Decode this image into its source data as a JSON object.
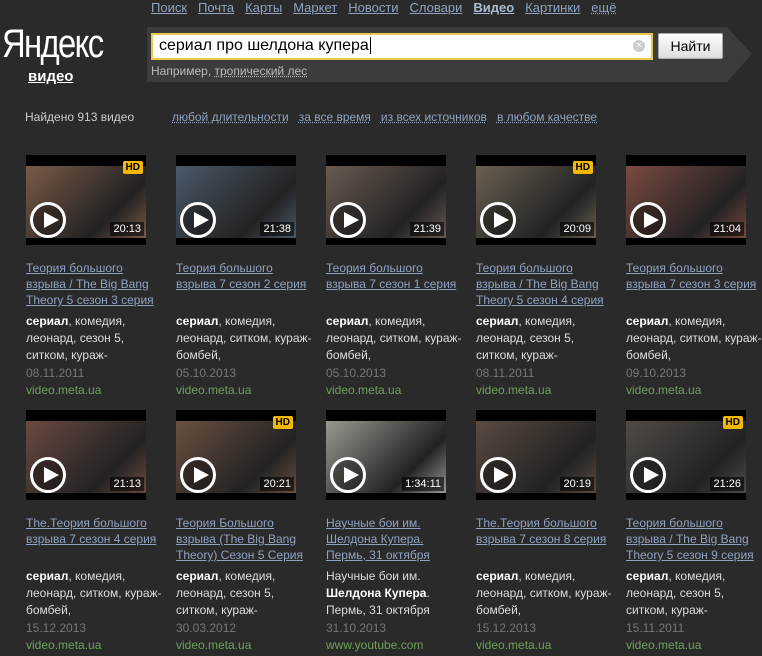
{
  "nav": [
    "Поиск",
    "Почта",
    "Карты",
    "Маркет",
    "Новости",
    "Словари",
    "Видео",
    "Картинки",
    "ещё"
  ],
  "logo": "Яндекс",
  "service": "видео",
  "search": {
    "value": "сериал про шелдона купера",
    "button": "Найти",
    "hint_prefix": "Например,",
    "hint_link": "тропический лес"
  },
  "found": "Найдено 913 видео",
  "filters": [
    "любой длительности",
    "за все время",
    "из всех источников",
    "в любом качестве"
  ],
  "videos": [
    {
      "title": "Теория большого взрыва / The Big Bang Theory 5 сезон 3 серия",
      "bold": "сериал",
      "desc": ", комедия, леонард, сезон 5, ситком, кураж-",
      "date": "08.11.2011",
      "source": "video.meta.ua",
      "duration": "20:13",
      "hd": "HD",
      "color": "#7a5a48"
    },
    {
      "title": "Теория большого взрыва 7 сезон 2 серия",
      "bold": "сериал",
      "desc": ", комедия, леонард, ситком, кураж-бомбей,",
      "date": "05.10.2013",
      "source": "video.meta.ua",
      "duration": "21:38",
      "color": "#4a5a6a"
    },
    {
      "title": "Теория большого взрыва 7 сезон 1 серия",
      "bold": "сериал",
      "desc": ", комедия, леонард, ситком, кураж-бомбей,",
      "date": "05.10.2013",
      "source": "video.meta.ua",
      "duration": "21:39",
      "color": "#6a5a50"
    },
    {
      "title": "Теория большого взрыва / The Big Bang Theory 5 сезон 4 серия",
      "bold": "сериал",
      "desc": ", комедия, леонард, сезон 5, ситком, кураж-",
      "date": "08.11.2011",
      "source": "video.meta.ua",
      "duration": "20:09",
      "hd": "HD",
      "color": "#6a6050"
    },
    {
      "title": "Теория большого взрыва 7 сезон 3 серия",
      "bold": "сериал",
      "desc": ", комедия, леонард, ситком, кураж-бомбей,",
      "date": "09.10.2013",
      "source": "video.meta.ua",
      "duration": "21:04",
      "color": "#7a4a40"
    },
    {
      "title": "The.Теория большого взрыва 7 сезон 4 серия",
      "bold": "сериал",
      "desc": ", комедия, леонард, ситком, кураж-бомбей,",
      "date": "15.12.2013",
      "source": "video.meta.ua",
      "duration": "21:13",
      "color": "#6a4a40"
    },
    {
      "title": "Теория Большого взрыва (The Big Bang Theory) Сезон 5 Серия",
      "bold": "сериал",
      "desc": ", комедия, леонард, сезон 5, ситком, кураж-",
      "date": "30.03.2012",
      "source": "video.meta.ua",
      "duration": "20:21",
      "hd": "HD",
      "color": "#6a5040"
    },
    {
      "title": "Научные бои им. Шелдона Купера. Пермь, 31 октября",
      "pre": "Научные бои им. ",
      "bold": "Шелдона Купера",
      "desc": ". Пермь, 31 октября",
      "date": "31.10.2013",
      "source": "www.youtube.com",
      "duration": "1:34:11",
      "color": "#9a9890"
    },
    {
      "title": "The.Теория большого взрыва 7 сезон 8 серия",
      "bold": "сериал",
      "desc": ", комедия, леонард, ситком, кураж-бомбей,",
      "date": "15.12.2013",
      "source": "video.meta.ua",
      "duration": "20:19",
      "color": "#5a4a40"
    },
    {
      "title": "Теория большого взрыва / The Big Bang Theory 5 сезон 9 серия",
      "bold": "сериал",
      "desc": ", комедия, леонард, сезон 5, ситком, кураж-",
      "date": "15.11.2011",
      "source": "video.meta.ua",
      "duration": "21:26",
      "hd": "HD",
      "color": "#504a45"
    }
  ]
}
